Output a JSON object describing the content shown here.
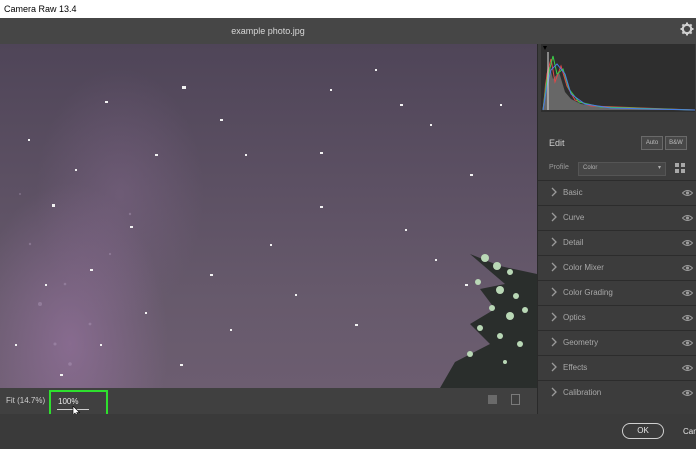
{
  "window": {
    "title": "Camera Raw 13.4"
  },
  "document": {
    "filename": "example photo.jpg"
  },
  "status": {
    "fit_label": "Fit (14.7%)",
    "zoom_value": "100%"
  },
  "panel": {
    "edit_label": "Edit",
    "auto_label": "Auto",
    "bw_label": "B&W",
    "profile_label": "Profile",
    "profile_value": "Color",
    "sections": [
      "Basic",
      "Curve",
      "Detail",
      "Color Mixer",
      "Color Grading",
      "Optics",
      "Geometry",
      "Effects",
      "Calibration"
    ]
  },
  "footer": {
    "ok_label": "OK",
    "cancel_label": "Cancel"
  },
  "colors": {
    "highlight": "#2ee02e",
    "panel_bg": "#3c3c3c",
    "sky": "#5c5063"
  }
}
